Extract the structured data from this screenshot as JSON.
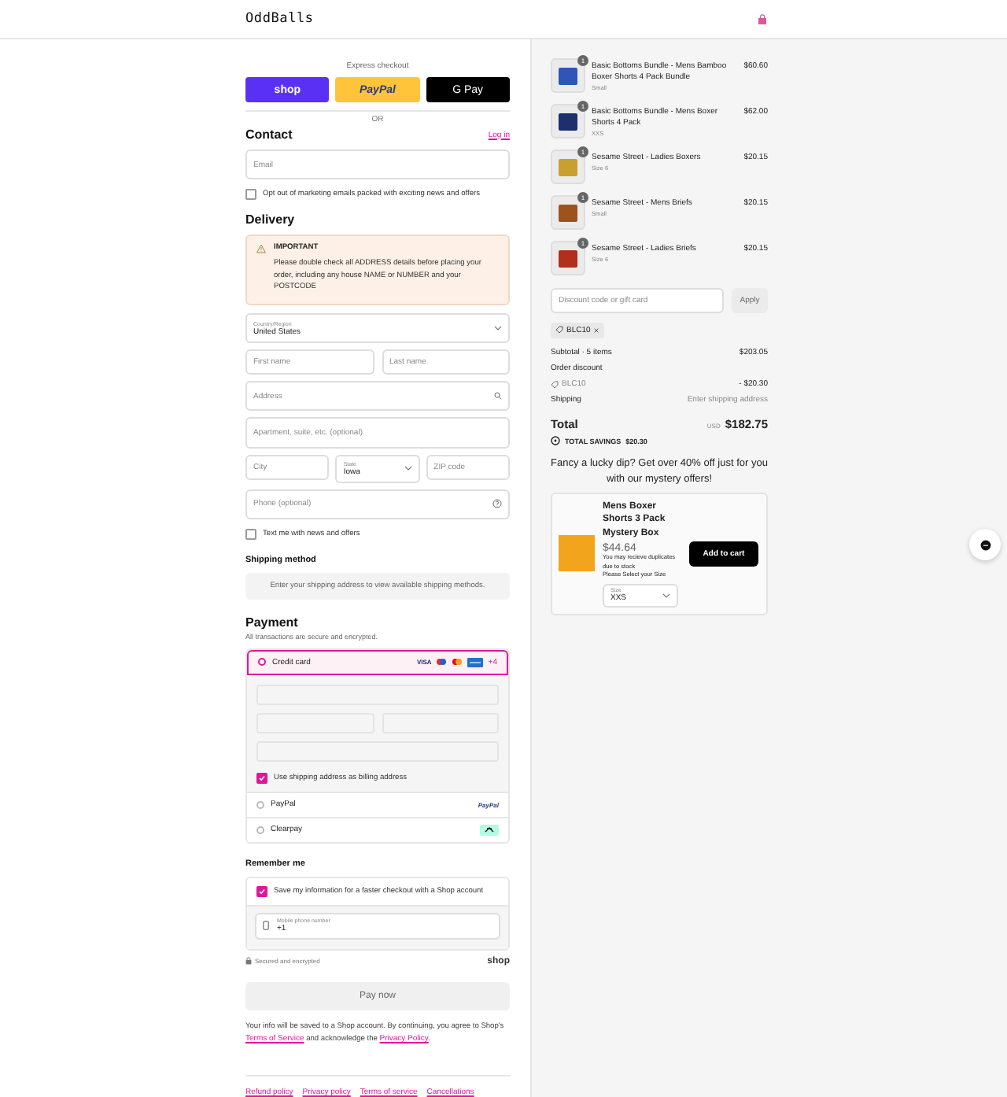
{
  "header": {
    "logo": "OddBalls"
  },
  "express": {
    "label": "Express checkout",
    "buttons": [
      {
        "kind": "shop",
        "label": "shop"
      },
      {
        "kind": "paypal",
        "label": "PayPal"
      },
      {
        "kind": "gpay",
        "label": "G Pay"
      }
    ],
    "divider": "OR"
  },
  "contact": {
    "heading": "Contact",
    "login": "Log in",
    "email": {
      "placeholder": "Email"
    },
    "marketing": {
      "label": "Opt out of marketing emails packed with exciting news and offers",
      "checked": false
    }
  },
  "delivery": {
    "heading": "Delivery",
    "notice": {
      "title": "IMPORTANT",
      "text": "Please double check all ADDRESS details before placing your order, including any house NAME or NUMBER and your POSTCODE"
    },
    "country": {
      "label": "Country/Region",
      "value": "United States"
    },
    "first_name": {
      "placeholder": "First name"
    },
    "last_name": {
      "placeholder": "Last name"
    },
    "address": {
      "placeholder": "Address"
    },
    "apartment": {
      "placeholder": "Apartment, suite, etc. (optional)"
    },
    "city": {
      "placeholder": "City"
    },
    "state": {
      "label": "State",
      "value": "Iowa"
    },
    "zip": {
      "placeholder": "ZIP code"
    },
    "phone": {
      "placeholder": "Phone (optional)"
    },
    "text_me": {
      "label": "Text me with news and offers",
      "checked": false
    }
  },
  "shipping_method": {
    "heading": "Shipping method",
    "message": "Enter your shipping address to view available shipping methods."
  },
  "payment": {
    "heading": "Payment",
    "subtitle": "All transactions are secure and encrypted.",
    "card_brand_text": "VISA",
    "more_brands": "+4",
    "methods": [
      {
        "kind": "card",
        "label": "Credit card",
        "selected": true
      },
      {
        "kind": "paypal",
        "label": "PayPal",
        "logo": "PayPal",
        "selected": false
      },
      {
        "kind": "clearpay",
        "label": "Clearpay",
        "selected": false
      }
    ],
    "billing": {
      "label": "Use shipping address as billing address",
      "checked": true
    }
  },
  "remember": {
    "heading": "Remember me",
    "save": {
      "label": "Save my information for a faster checkout with a Shop account",
      "checked": true
    },
    "mobile": {
      "label": "Mobile phone number",
      "value": "+1"
    },
    "secured": "Secured and encrypted",
    "shop_logo": "shop"
  },
  "pay_button": "Pay now",
  "info": [
    {
      "text": "Your info will be saved to a Shop account. By continuing, you agree to Shop's ",
      "link": false
    },
    {
      "text": "Terms of Service",
      "link": true
    },
    {
      "text": " and acknowledge the ",
      "link": false
    },
    {
      "text": "Privacy Policy",
      "link": true
    },
    {
      "text": ".",
      "link": false
    }
  ],
  "footer_links": [
    "Refund policy",
    "Privacy policy",
    "Terms of service",
    "Cancellations"
  ],
  "summary": {
    "items": [
      {
        "name": "Basic Bottoms Bundle - Mens Bamboo Boxer Shorts 4 Pack Bundle",
        "variant": "Small",
        "price": "$60.60",
        "quantity": "1",
        "color": "#2f55b8"
      },
      {
        "name": "Basic Bottoms Bundle - Mens Boxer Shorts 4 Pack",
        "variant": "XXS",
        "price": "$62.00",
        "quantity": "1",
        "color": "#1c2f6e"
      },
      {
        "name": "Sesame Street - Ladies Boxers",
        "variant": "Size 6",
        "price": "$20.15",
        "quantity": "1",
        "color": "#c9a030"
      },
      {
        "name": "Sesame Street - Mens Briefs",
        "variant": "Small",
        "price": "$20.15",
        "quantity": "1",
        "color": "#a0521c"
      },
      {
        "name": "Sesame Street - Ladies Briefs",
        "variant": "Size 6",
        "price": "$20.15",
        "quantity": "1",
        "color": "#b0301c"
      }
    ],
    "discount": {
      "placeholder": "Discount code or gift card",
      "button": "Apply"
    },
    "applied_code": "BLC10",
    "subtotal": {
      "label": "Subtotal · 5 items",
      "value": "$203.05"
    },
    "order_discount": {
      "label": "Order discount",
      "code": "BLC10",
      "value": "- $20.30"
    },
    "shipping": {
      "label": "Shipping",
      "value": "Enter shipping address"
    },
    "total": {
      "label": "Total",
      "currency": "USD",
      "value": "$182.75"
    },
    "savings": {
      "label": "TOTAL SAVINGS",
      "value": "$20.30"
    },
    "promo": {
      "text": "Fancy a lucky dip? Get over 40% off just for you with our mystery offers!",
      "title": "Mens Boxer Shorts 3 Pack Mystery Box",
      "price": "$44.64",
      "note": "You may recieve duplicates due to stock",
      "prompt": "Please Select your Size",
      "size": {
        "label": "Size",
        "value": "XXS"
      },
      "button": "Add to cart"
    }
  }
}
